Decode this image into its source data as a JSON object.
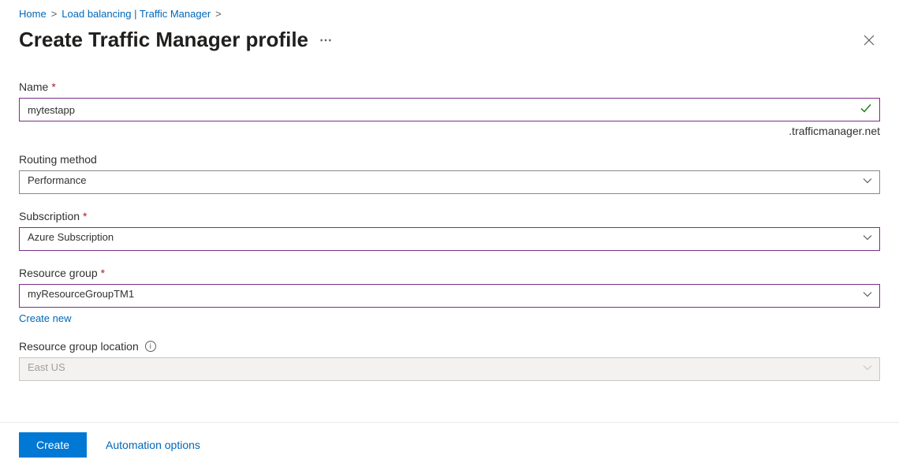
{
  "breadcrumb": {
    "home": "Home",
    "lb": "Load balancing | Traffic Manager"
  },
  "header": {
    "title": "Create Traffic Manager profile"
  },
  "form": {
    "name": {
      "label": "Name",
      "value": "mytestapp",
      "suffix": ".trafficmanager.net"
    },
    "routing": {
      "label": "Routing method",
      "value": "Performance"
    },
    "subscription": {
      "label": "Subscription",
      "value": "Azure Subscription"
    },
    "resourceGroup": {
      "label": "Resource group",
      "value": "myResourceGroupTM1",
      "createNew": "Create new"
    },
    "location": {
      "label": "Resource group location",
      "value": "East US"
    }
  },
  "footer": {
    "create": "Create",
    "automation": "Automation options"
  }
}
